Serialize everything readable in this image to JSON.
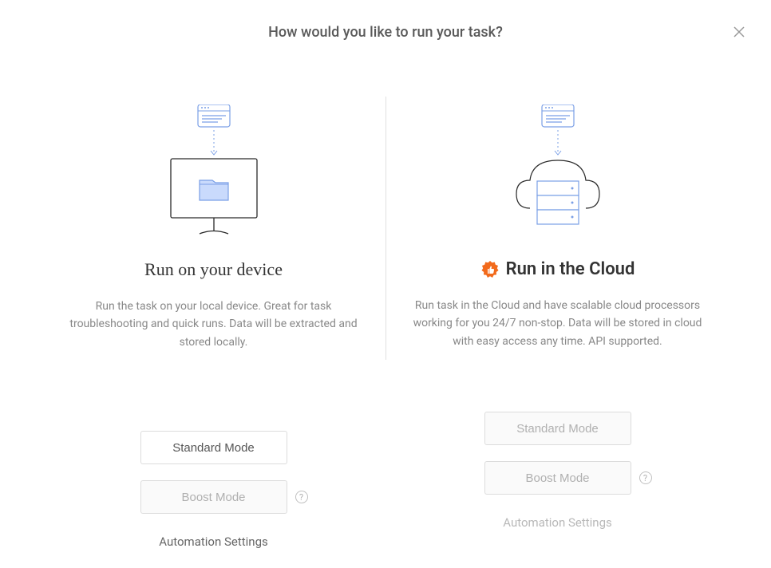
{
  "dialog": {
    "title": "How would you like to run your task?"
  },
  "device": {
    "heading": "Run on your device",
    "description": "Run the task on your local device. Great for task troubleshooting and quick runs. Data will be extracted and stored locally.",
    "standard_label": "Standard Mode",
    "boost_label": "Boost Mode",
    "settings_label": "Automation Settings"
  },
  "cloud": {
    "heading": "Run in the Cloud",
    "description": "Run task in the Cloud and have scalable cloud processors working for you 24/7 non-stop. Data will be stored in cloud with easy access any time. API supported.",
    "standard_label": "Standard Mode",
    "boost_label": "Boost Mode",
    "settings_label": "Automation Settings"
  },
  "help_glyph": "?"
}
